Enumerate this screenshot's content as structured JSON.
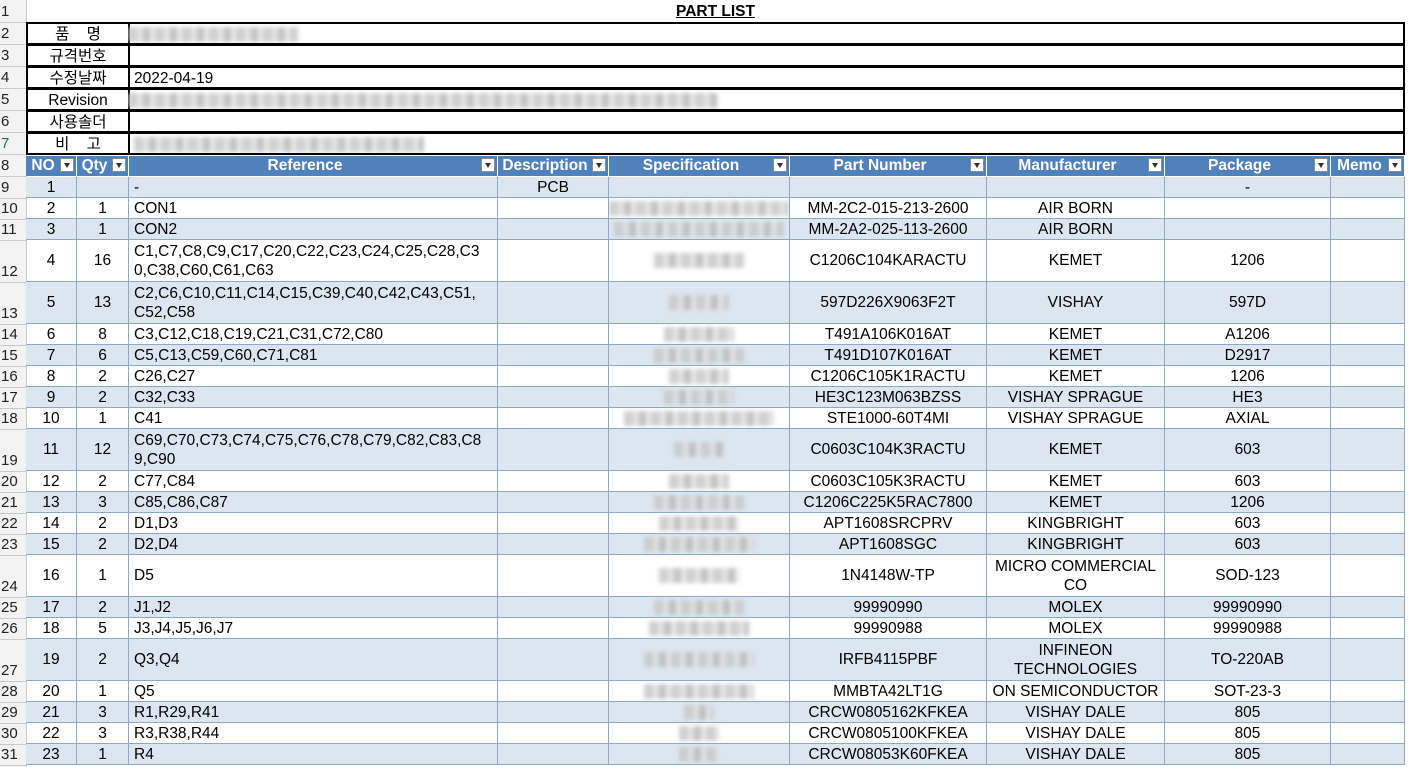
{
  "row_numbers": [
    "1",
    "2",
    "3",
    "4",
    "5",
    "6",
    "7",
    "8",
    "9",
    "10",
    "11",
    "12",
    "13",
    "14",
    "15",
    "16",
    "17",
    "18",
    "19",
    "20",
    "21",
    "22",
    "23",
    "24",
    "25",
    "26",
    "27",
    "28",
    "29",
    "30",
    "31"
  ],
  "title": "PART LIST",
  "info": [
    {
      "label": "품    명",
      "value": ""
    },
    {
      "label": "규격번호",
      "value": ""
    },
    {
      "label": "수정날짜",
      "value": "2022-04-19"
    },
    {
      "label": "Revision",
      "value": ""
    },
    {
      "label": "사용솔더",
      "value": ""
    },
    {
      "label": "비    고",
      "value": ""
    }
  ],
  "columns": [
    "NO",
    "Qty",
    "Reference",
    "Description",
    "Specification",
    "Part Number",
    "Manufacturer",
    "Package",
    "Memo"
  ],
  "rows": [
    {
      "no": "1",
      "qty": "",
      "ref": "-",
      "desc": "PCB",
      "pn": "",
      "mfr": "",
      "pkg": "-"
    },
    {
      "no": "2",
      "qty": "1",
      "ref": "CON1",
      "desc": "",
      "pn": "MM-2C2-015-213-2600",
      "mfr": "AIR BORN",
      "pkg": ""
    },
    {
      "no": "3",
      "qty": "1",
      "ref": "CON2",
      "desc": "",
      "pn": "MM-2A2-025-113-2600",
      "mfr": "AIR BORN",
      "pkg": ""
    },
    {
      "no": "4",
      "qty": "16",
      "ref": "C1,C7,C8,C9,C17,C20,C22,C23,C24,C25,C28,C3 0,C38,C60,C61,C63",
      "ref1": "C1,C7,C8,C9,C17,C20,C22,C23,C24,C25,C28,C3",
      "ref2": "0,C38,C60,C61,C63",
      "desc": "",
      "pn": "C1206C104KARACTU",
      "mfr": "KEMET",
      "pkg": "1206"
    },
    {
      "no": "5",
      "qty": "13",
      "ref": "C2,C6,C10,C11,C14,C15,C39,C40,C42,C43,C51, C52,C58",
      "ref1": "C2,C6,C10,C11,C14,C15,C39,C40,C42,C43,C51,",
      "ref2": "C52,C58",
      "desc": "",
      "pn": "597D226X9063F2T",
      "mfr": "VISHAY",
      "pkg": "597D"
    },
    {
      "no": "6",
      "qty": "8",
      "ref": "C3,C12,C18,C19,C21,C31,C72,C80",
      "desc": "",
      "pn": "T491A106K016AT",
      "mfr": "KEMET",
      "pkg": "A1206"
    },
    {
      "no": "7",
      "qty": "6",
      "ref": "C5,C13,C59,C60,C71,C81",
      "desc": "",
      "pn": "T491D107K016AT",
      "mfr": "KEMET",
      "pkg": "D2917"
    },
    {
      "no": "8",
      "qty": "2",
      "ref": "C26,C27",
      "desc": "",
      "pn": "C1206C105K1RACTU",
      "mfr": "KEMET",
      "pkg": "1206"
    },
    {
      "no": "9",
      "qty": "2",
      "ref": "C32,C33",
      "desc": "",
      "pn": "HE3C123M063BZSS",
      "mfr": "VISHAY SPRAGUE",
      "pkg": "HE3"
    },
    {
      "no": "10",
      "qty": "1",
      "ref": "C41",
      "desc": "",
      "pn": "STE1000-60T4MI",
      "mfr": "VISHAY SPRAGUE",
      "pkg": "AXIAL"
    },
    {
      "no": "11",
      "qty": "12",
      "ref": "C69,C70,C73,C74,C75,C76,C78,C79,C82,C83,C8 9,C90",
      "ref1": "C69,C70,C73,C74,C75,C76,C78,C79,C82,C83,C8",
      "ref2": "9,C90",
      "desc": "",
      "pn": "C0603C104K3RACTU",
      "mfr": "KEMET",
      "pkg": "603"
    },
    {
      "no": "12",
      "qty": "2",
      "ref": "C77,C84",
      "desc": "",
      "pn": "C0603C105K3RACTU",
      "mfr": "KEMET",
      "pkg": "603"
    },
    {
      "no": "13",
      "qty": "3",
      "ref": "C85,C86,C87",
      "desc": "",
      "pn": "C1206C225K5RAC7800",
      "mfr": "KEMET",
      "pkg": "1206"
    },
    {
      "no": "14",
      "qty": "2",
      "ref": "D1,D3",
      "desc": "",
      "pn": "APT1608SRCPRV",
      "mfr": "KINGBRIGHT",
      "pkg": "603"
    },
    {
      "no": "15",
      "qty": "2",
      "ref": "D2,D4",
      "desc": "",
      "pn": "APT1608SGC",
      "mfr": "KINGBRIGHT",
      "pkg": "603"
    },
    {
      "no": "16",
      "qty": "1",
      "ref": "D5",
      "desc": "",
      "pn": "1N4148W-TP",
      "mfr": "MICRO COMMERCIAL CO",
      "mfr1": "MICRO COMMERCIAL",
      "mfr2": "CO",
      "pkg": "SOD-123"
    },
    {
      "no": "17",
      "qty": "2",
      "ref": "J1,J2",
      "desc": "",
      "pn": "99990990",
      "mfr": "MOLEX",
      "pkg": "99990990"
    },
    {
      "no": "18",
      "qty": "5",
      "ref": "J3,J4,J5,J6,J7",
      "desc": "",
      "pn": "99990988",
      "mfr": "MOLEX",
      "pkg": "99990988"
    },
    {
      "no": "19",
      "qty": "2",
      "ref": "Q3,Q4",
      "desc": "",
      "pn": "IRFB4115PBF",
      "mfr": "INFINEON TECHNOLOGIES",
      "mfr1": "INFINEON",
      "mfr2": "TECHNOLOGIES",
      "pkg": "TO-220AB"
    },
    {
      "no": "20",
      "qty": "1",
      "ref": "Q5",
      "desc": "",
      "pn": "MMBTA42LT1G",
      "mfr": "ON SEMICONDUCTOR",
      "pkg": "SOT-23-3"
    },
    {
      "no": "21",
      "qty": "3",
      "ref": "R1,R29,R41",
      "desc": "",
      "pn": "CRCW0805162KFKEA",
      "mfr": "VISHAY DALE",
      "pkg": "805"
    },
    {
      "no": "22",
      "qty": "3",
      "ref": "R3,R38,R44",
      "desc": "",
      "pn": "CRCW0805100KFKEA",
      "mfr": "VISHAY DALE",
      "pkg": "805"
    },
    {
      "no": "23",
      "qty": "1",
      "ref": "R4",
      "desc": "",
      "pn": "CRCW08053K60FKEA",
      "mfr": "VISHAY DALE",
      "pkg": "805"
    }
  ],
  "colors": {
    "header_blue": "#4f81bd",
    "band_blue": "#dce6f1",
    "active_row_number": "#217346"
  }
}
